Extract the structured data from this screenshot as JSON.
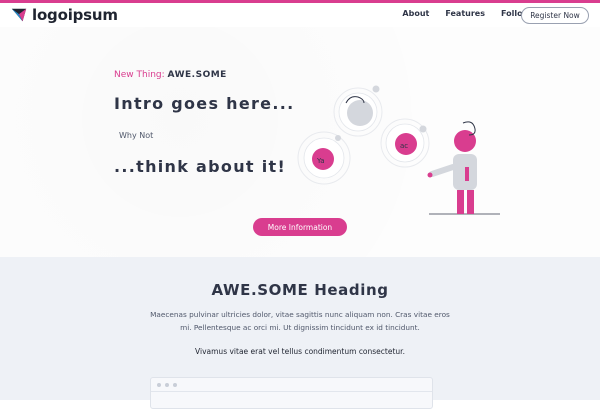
{
  "brand": {
    "name": "logoipsum",
    "accent": "#d93d8f"
  },
  "nav": {
    "links": [
      "About",
      "Features",
      "Follow"
    ],
    "register_label": "Register Now"
  },
  "hero": {
    "eyebrow_prefix": "New Thing:",
    "eyebrow_strong": "AWE.SOME",
    "intro": "Intro goes here...",
    "subtext": "Why Not",
    "tagline": "...think about it!",
    "cta_label": "More Information"
  },
  "section2": {
    "heading": "AWE.SOME Heading",
    "paragraph": "Maecenas pulvinar ultricies dolor, vitae sagittis nunc aliquam non. Cras vitae eros mi. Pellentesque ac orci mi. Ut dignissim tincidunt ex id tincidunt.",
    "line2": "Vivamus vitae erat vel tellus condimentum consectetur."
  }
}
